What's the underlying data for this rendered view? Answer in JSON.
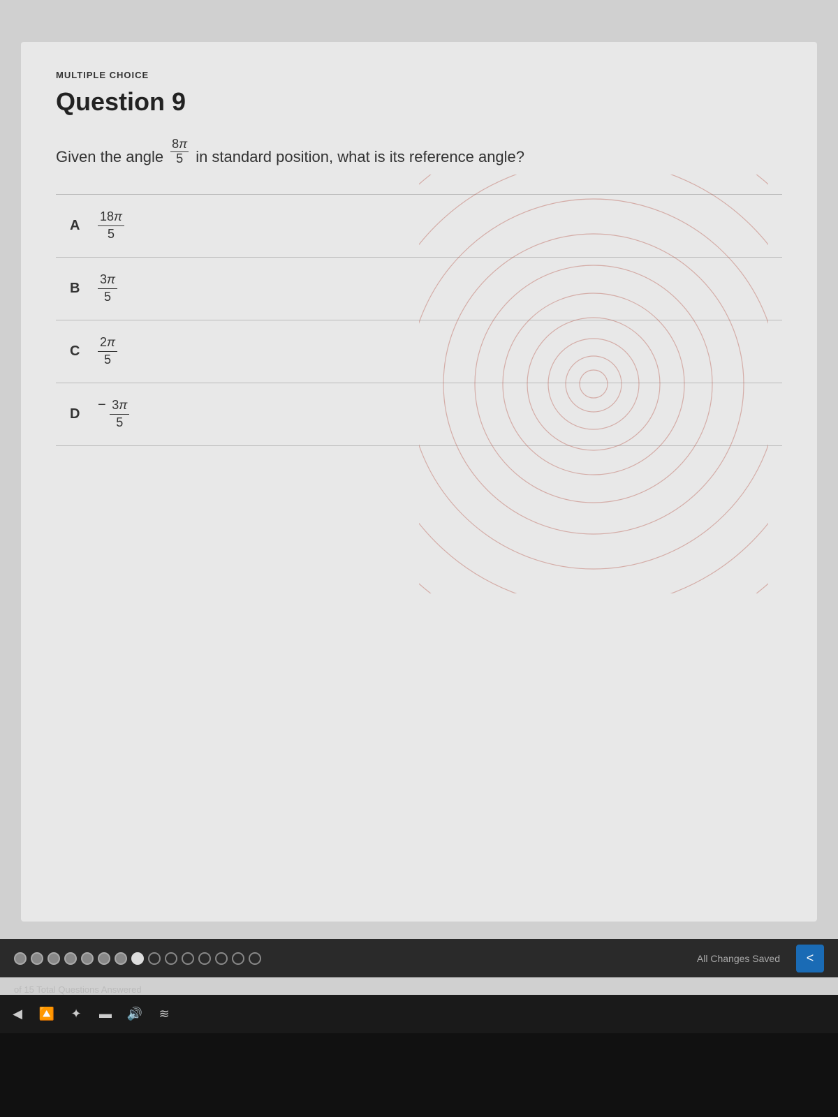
{
  "question_type": "MULTIPLE CHOICE",
  "question_number": "Question 9",
  "question_text_before": "Given the angle",
  "question_angle_numerator": "8π",
  "question_angle_denominator": "5",
  "question_text_after": "in standard position, what is its reference angle?",
  "choices": [
    {
      "letter": "A",
      "numerator": "18π",
      "denominator": "5",
      "negative": false
    },
    {
      "letter": "B",
      "numerator": "3π",
      "denominator": "5",
      "negative": false
    },
    {
      "letter": "C",
      "numerator": "2π",
      "denominator": "5",
      "negative": false
    },
    {
      "letter": "D",
      "numerator": "3π",
      "denominator": "5",
      "negative": true
    }
  ],
  "bottom_bar": {
    "all_changes_saved": "All Changes Saved",
    "questions_count": "of 15 Total Questions Answered",
    "nav_back": "<"
  },
  "progress": {
    "answered_count": 8,
    "current_index": 8,
    "total": 15
  }
}
